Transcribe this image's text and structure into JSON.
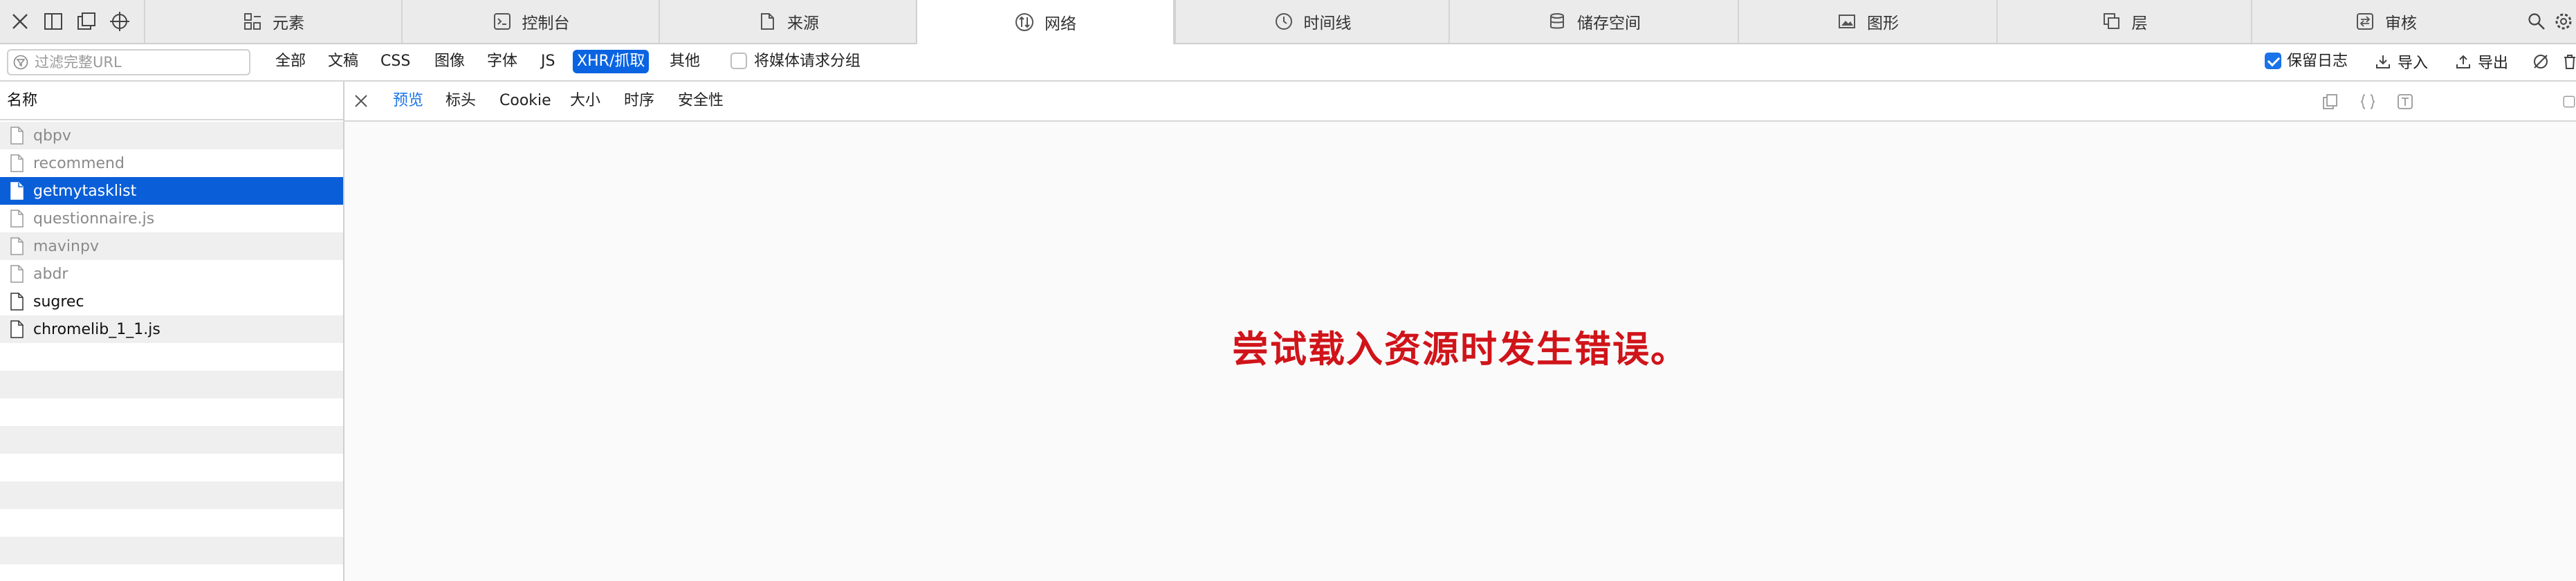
{
  "toolbar": {
    "tabs": [
      {
        "label": "元素",
        "icon": "elements-icon"
      },
      {
        "label": "控制台",
        "icon": "console-icon"
      },
      {
        "label": "来源",
        "icon": "sources-icon"
      },
      {
        "label": "网络",
        "icon": "network-icon",
        "active": true
      },
      {
        "label": "时间线",
        "icon": "timeline-icon"
      },
      {
        "label": "储存空间",
        "icon": "storage-icon"
      },
      {
        "label": "图形",
        "icon": "graphics-icon"
      },
      {
        "label": "层",
        "icon": "layers-icon"
      },
      {
        "label": "审核",
        "icon": "audit-icon"
      }
    ]
  },
  "filter": {
    "placeholder": "过滤完整URL",
    "types": [
      "全部",
      "文稿",
      "CSS",
      "图像",
      "字体",
      "JS",
      "XHR/抓取",
      "其他"
    ],
    "selected_type": "XHR/抓取",
    "group_media_label": "将媒体请求分组",
    "group_media_checked": false,
    "preserve_log_label": "保留日志",
    "preserve_log_checked": true,
    "import_label": "导入",
    "export_label": "导出"
  },
  "list": {
    "header": "名称",
    "items": [
      {
        "name": "qbpv",
        "style": "dim"
      },
      {
        "name": "recommend",
        "style": "dim"
      },
      {
        "name": "getmytasklist",
        "style": "selected"
      },
      {
        "name": "questionnaire.js",
        "style": "dim"
      },
      {
        "name": "mavinpv",
        "style": "dim"
      },
      {
        "name": "abdr",
        "style": "dim"
      },
      {
        "name": "sugrec",
        "style": "normal"
      },
      {
        "name": "chromelib_1_1.js",
        "style": "normal"
      }
    ]
  },
  "detail": {
    "tabs": [
      "预览",
      "标头",
      "Cookie",
      "大小",
      "时序",
      "安全性"
    ],
    "active_tab": "预览",
    "error_message": "尝试载入资源时发生错误。"
  },
  "colors": {
    "accent": "#1a73e8",
    "selected_row": "#0a5fd8",
    "error_text": "#d0141a"
  }
}
